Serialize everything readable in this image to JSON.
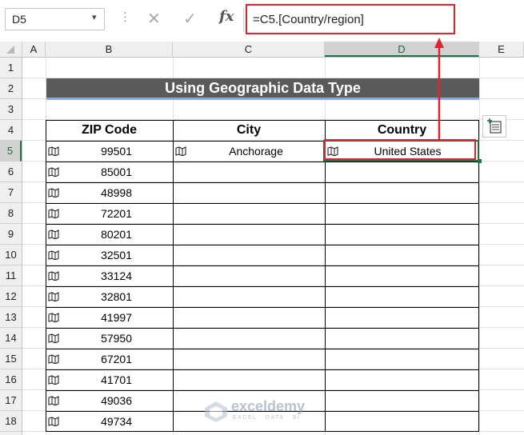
{
  "formula_bar": {
    "name_box": "D5",
    "formula": "=C5.[Country/region]",
    "fx_label": "fx",
    "cancel_glyph": "✕",
    "confirm_glyph": "✓",
    "dots": "⋮"
  },
  "columns": [
    "A",
    "B",
    "C",
    "D",
    "E"
  ],
  "rows": [
    "1",
    "2",
    "3",
    "4",
    "5",
    "6",
    "7",
    "8",
    "9",
    "10",
    "11",
    "12",
    "13",
    "14",
    "15",
    "16",
    "17",
    "18"
  ],
  "title": "Using Geographic Data Type",
  "table": {
    "headers": [
      "ZIP Code",
      "City",
      "Country"
    ],
    "zip_codes": [
      "99501",
      "85001",
      "48998",
      "72201",
      "80201",
      "32501",
      "33124",
      "32801",
      "41997",
      "57950",
      "67201",
      "41701",
      "49036",
      "49734"
    ],
    "city_row5": "Anchorage",
    "country_row5": "United States"
  },
  "selected_cell": "D5",
  "colors": {
    "title_bg": "#5a5a5a",
    "title_underline": "#8ea9db",
    "annotation_red": "#e0242f",
    "selection_green": "#217346"
  },
  "icons": {
    "data_type_icon": "map-icon",
    "insert_data_icon": "insert-data-icon"
  },
  "watermark": {
    "name": "exceldemy",
    "tagline": "EXCEL · DATA · BI"
  }
}
